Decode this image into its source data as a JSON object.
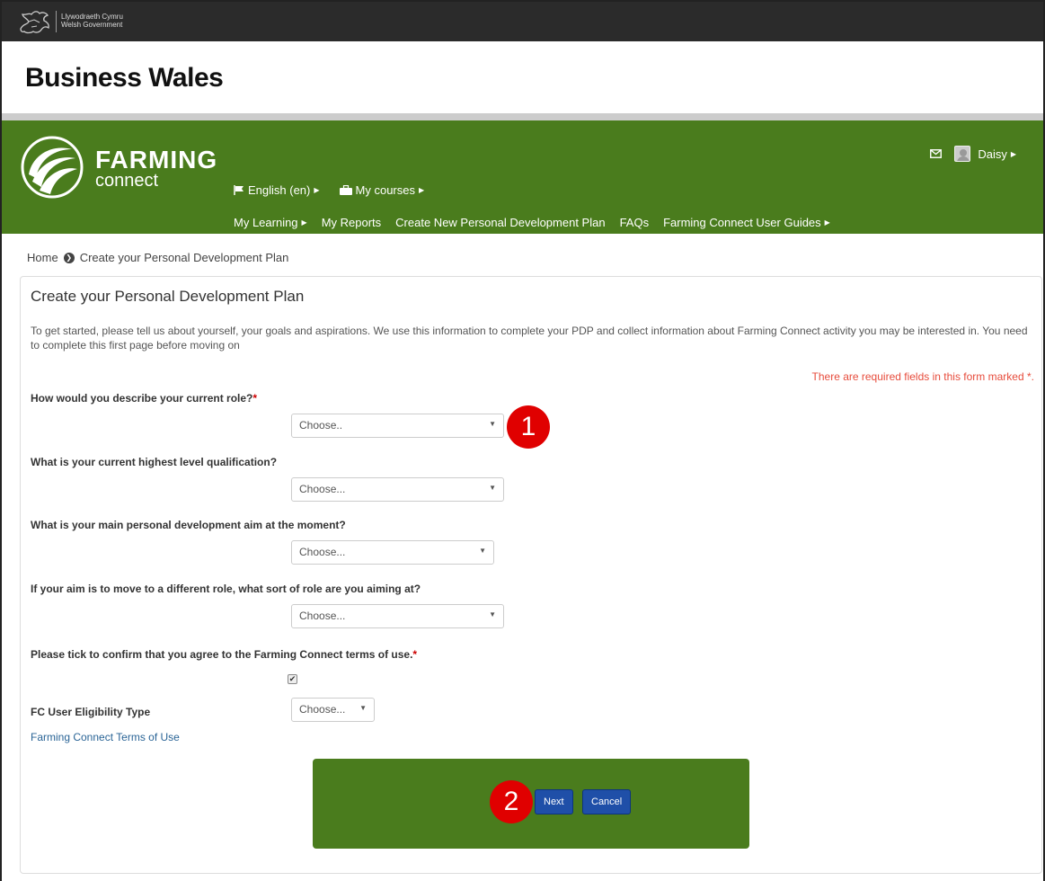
{
  "gov_bar": {
    "line1": "Llywodraeth Cymru",
    "line2": "Welsh Government"
  },
  "site_title": "Business Wales",
  "brand": {
    "name_big": "FARMING",
    "name_small": "connect"
  },
  "nav": {
    "language": "English (en)",
    "my_courses": "My courses",
    "items": [
      "My Learning",
      "My Reports",
      "Create New Personal Development Plan",
      "FAQs",
      "Farming Connect User Guides"
    ]
  },
  "user": {
    "name": "Daisy"
  },
  "breadcrumb": {
    "home": "Home",
    "current": "Create your Personal Development Plan"
  },
  "form": {
    "title": "Create your Personal Development Plan",
    "intro": "To get started, please tell us about yourself, your goals and aspirations. We use this information to complete your PDP and collect information about Farming Connect activity you may be interested in. You need to complete this first page before moving on",
    "required_note": "There are required fields in this form marked",
    "required_star": "*",
    "q1": {
      "label": "How would you describe your current role?",
      "value": "Choose.."
    },
    "q2": {
      "label": "What is your current highest level qualification?",
      "value": "Choose..."
    },
    "q3": {
      "label": "What is your main personal development aim at the moment?",
      "value": "Choose..."
    },
    "q4": {
      "label": "If your aim is to move to a different role, what sort of role are you aiming at?",
      "value": "Choose..."
    },
    "q5": {
      "label": "Please tick to confirm that you agree to the Farming Connect terms of use.",
      "checked": true
    },
    "q6": {
      "label": "FC User Eligibility Type",
      "value": "Choose..."
    },
    "terms_link": "Farming Connect Terms of Use",
    "next_label": "Next",
    "cancel_label": "Cancel"
  },
  "annotations": {
    "one": "1",
    "two": "2"
  },
  "colors": {
    "nav_green": "#4a7c1d",
    "button_blue": "#1f4fa8",
    "annotation_red": "#e00000",
    "required_red": "#e74c3c"
  }
}
